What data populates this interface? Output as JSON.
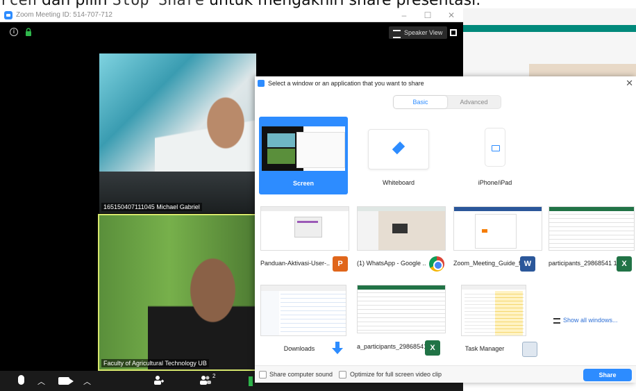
{
  "caption": {
    "text_pre": "",
    "code1": "rcen",
    "text_mid": " dan pilih ",
    "code2": "Stop Share",
    "text_post": " untuk mengakhiri share presentasi."
  },
  "zoom_window": {
    "title": "Zoom Meeting ID: 514-707-712",
    "controls": [
      "–",
      "☐",
      "✕"
    ],
    "speaker_view_label": "Speaker View",
    "participants": [
      {
        "name": "165150407111045 Michael Gabriel"
      },
      {
        "name": "Faculty of Agricultural Technology UB"
      }
    ],
    "toolbar": {
      "mic_icon": "microphone-icon",
      "video_icon": "video-camera-icon",
      "invite_icon": "invite-user-icon",
      "participants_icon": "participants-icon",
      "participants_count": "2"
    }
  },
  "share_dialog": {
    "title": "Select a window or an application that you want to share",
    "close_label": "✕",
    "tabs": [
      {
        "label": "Basic",
        "active": true
      },
      {
        "label": "Advanced",
        "active": false
      }
    ],
    "primary_tiles": [
      {
        "label": "Screen",
        "selected": true,
        "icon": "screen-thumbnail"
      },
      {
        "label": "Whiteboard",
        "selected": false,
        "icon": "pencil-icon"
      },
      {
        "label": "iPhone/iPad",
        "selected": false,
        "icon": "airplay-icon"
      }
    ],
    "windows": [
      {
        "label": "Panduan-Aktivasi-User-...",
        "app_icon": "ppt-icon",
        "app_color": "#e0661b"
      },
      {
        "label": "(1) WhatsApp - Google ...",
        "app_icon": "chrome-icon",
        "app_color": "#4285f4"
      },
      {
        "label": "Zoom_Meeting_Guide_f...",
        "app_icon": "word-icon",
        "app_color": "#2b579a",
        "app_letter": "W"
      },
      {
        "label": "participants_29868541 1.c...",
        "app_icon": "excel-icon",
        "app_color": "#217346",
        "app_letter": "X"
      },
      {
        "label": "Downloads",
        "app_icon": "download-arrow-icon",
        "app_color": "#2d8cff"
      },
      {
        "label": "a_participants_29868541...",
        "app_icon": "excel-icon",
        "app_color": "#217346",
        "app_letter": "X"
      },
      {
        "label": "Task Manager",
        "app_icon": "task-manager-icon",
        "app_color": "#5b7ea8"
      }
    ],
    "show_all_label": "Show all windows...",
    "footer": {
      "share_sound_label": "Share computer sound",
      "optimize_label": "Optimize for full screen video clip",
      "share_button_label": "Share"
    }
  },
  "colors": {
    "zoom_blue": "#2d8cff",
    "active_speaker_border": "#d7e86d",
    "teal_bar": "#00897b"
  }
}
